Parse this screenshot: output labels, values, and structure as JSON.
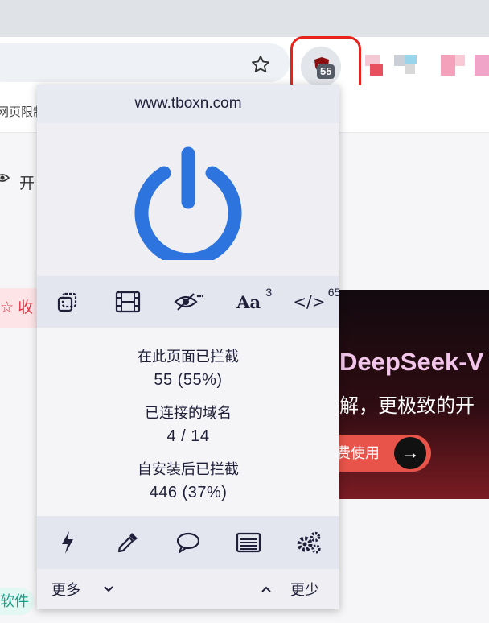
{
  "browser": {
    "bookmark_partial_text": "网页限制",
    "extension_badge": "55"
  },
  "background_page": {
    "open_text": "开",
    "favorite_text": "☆ 收",
    "banner_title": "DeepSeek-V",
    "banner_subtitle": "解，更极致的开",
    "banner_button": "费使用",
    "software_tag": "软件"
  },
  "popup": {
    "hostname": "www.tboxn.com",
    "tools": {
      "cosmetic_filter_count": "3",
      "scripts_count": "65",
      "fonts_label": "Aa",
      "scripts_label": "</>"
    },
    "stats": {
      "blocked_page_label": "在此页面已拦截",
      "blocked_page_value": "55 (55%)",
      "domains_label": "已连接的域名",
      "domains_value": "4 / 14",
      "blocked_total_label": "自安装后已拦截",
      "blocked_total_value": "446 (37%)"
    },
    "footer": {
      "more_label": "更多",
      "less_label": "更少"
    }
  },
  "colors": {
    "power_blue": "#2e74de",
    "highlight_red": "#e8231b",
    "ink": "#1f1f3a"
  }
}
